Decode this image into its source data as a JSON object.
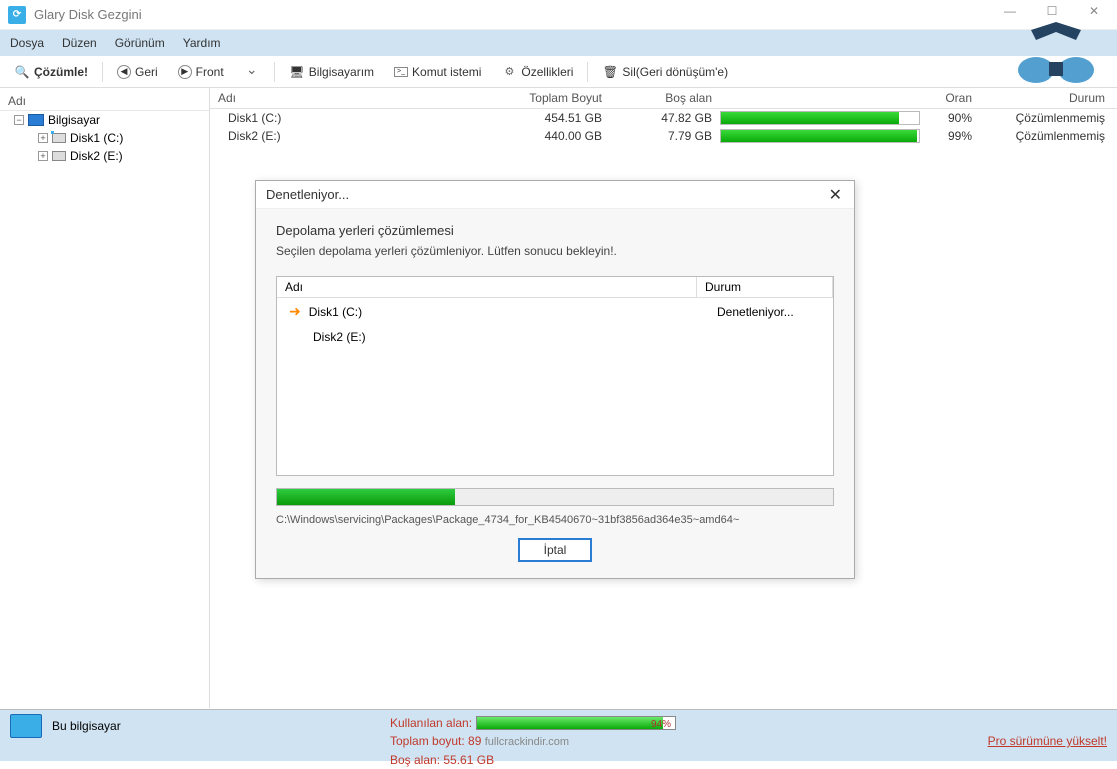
{
  "title": "Glary Disk Gezgini",
  "menu": {
    "file": "Dosya",
    "layout": "Düzen",
    "view": "Görünüm",
    "help": "Yardım"
  },
  "toolbar": {
    "analyze": "Çözümle!",
    "back": "Geri",
    "front": "Front",
    "computer": "Bilgisayarım",
    "cmd": "Komut istemi",
    "props": "Özellikleri",
    "delete": "Sil(Geri dönüşüm'e)"
  },
  "tree": {
    "header": "Adı",
    "root": "Bilgisayar",
    "disk1": "Disk1 (C:)",
    "disk2": "Disk2 (E:)"
  },
  "list": {
    "headers": {
      "name": "Adı",
      "total": "Toplam Boyut",
      "free": "Boş alan",
      "ratio": "Oran",
      "status": "Durum"
    },
    "rows": [
      {
        "name": "Disk1 (C:)",
        "total": "454.51 GB",
        "free": "47.82 GB",
        "pct": "90%",
        "status": "Çözümlenmemiş",
        "fill": 90
      },
      {
        "name": "Disk2 (E:)",
        "total": "440.00 GB",
        "free": "7.79 GB",
        "pct": "99%",
        "status": "Çözümlenmemiş",
        "fill": 99
      }
    ]
  },
  "dialog": {
    "title": "Denetleniyor...",
    "heading": "Depolama yerleri çözümlemesi",
    "sub": "Seçilen depolama yerleri çözümleniyor. Lütfen sonucu bekleyin!.",
    "col_name": "Adı",
    "col_status": "Durum",
    "rows": [
      {
        "name": "Disk1 (C:)",
        "status": "Denetleniyor...",
        "active": true
      },
      {
        "name": "Disk2 (E:)",
        "status": "",
        "active": false
      }
    ],
    "path": "C:\\Windows\\servicing\\Packages\\Package_4734_for_KB4540670~31bf3856ad364e35~amd64~",
    "cancel": "İptal"
  },
  "status": {
    "computer": "Bu bilgisayar",
    "used_label": "Kullanılan alan:",
    "used_pct": "94%",
    "total_label": "Toplam boyut: 89",
    "watermark": "fullcrackindir.com",
    "free_label": "Boş alan: 55.61 GB",
    "upgrade": "Pro sürümüne yükselt!"
  }
}
